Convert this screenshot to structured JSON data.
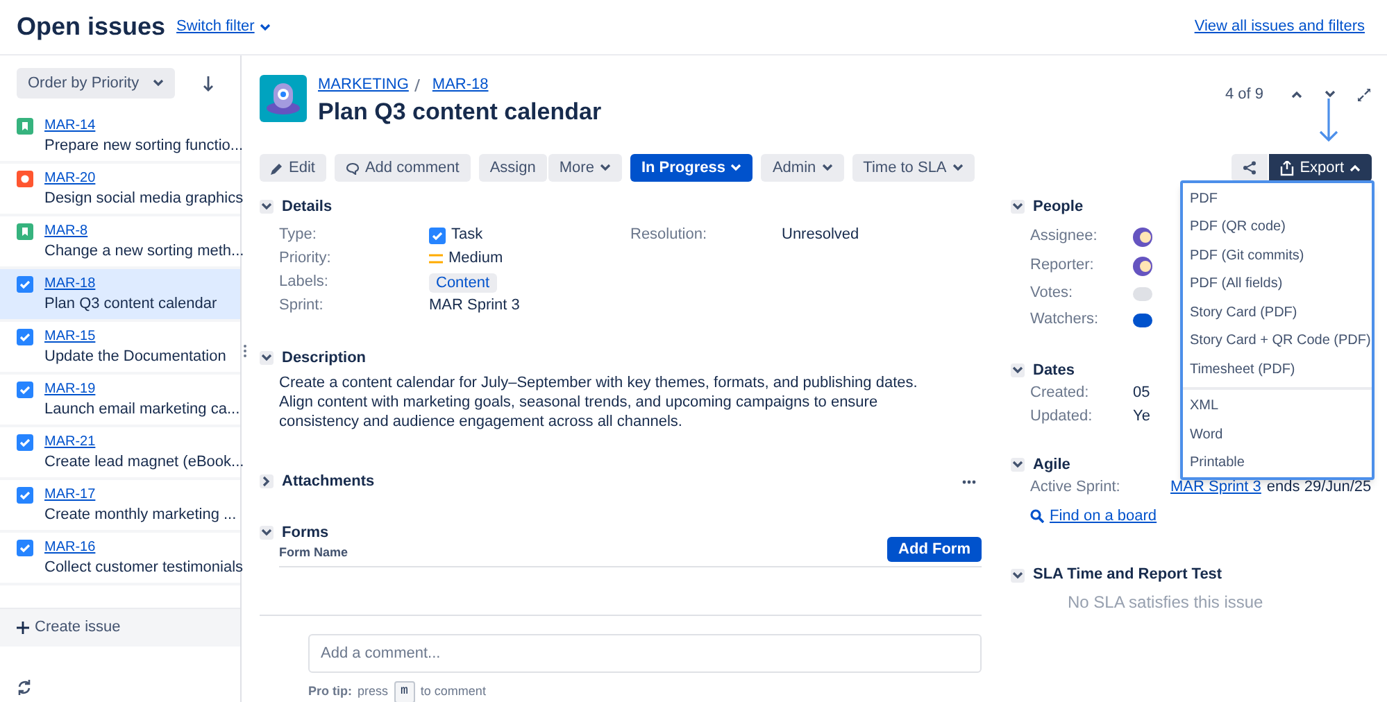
{
  "header": {
    "title": "Open issues",
    "switch_filter": "Switch filter",
    "view_all": "View all issues and filters"
  },
  "sidebar": {
    "order_by": "Order by Priority",
    "issues": [
      {
        "key": "MAR-14",
        "summary": "Prepare new sorting functio...",
        "kind": "story",
        "selected": false
      },
      {
        "key": "MAR-20",
        "summary": "Design social media graphics",
        "kind": "bug",
        "selected": false
      },
      {
        "key": "MAR-8",
        "summary": "Change a new sorting meth...",
        "kind": "story",
        "selected": false
      },
      {
        "key": "MAR-18",
        "summary": "Plan Q3 content calendar",
        "kind": "task",
        "selected": true
      },
      {
        "key": "MAR-15",
        "summary": "Update the Documentation",
        "kind": "task",
        "selected": false
      },
      {
        "key": "MAR-19",
        "summary": "Launch email marketing ca...",
        "kind": "task",
        "selected": false
      },
      {
        "key": "MAR-21",
        "summary": "Create lead magnet (eBook...",
        "kind": "task",
        "selected": false
      },
      {
        "key": "MAR-17",
        "summary": "Create monthly marketing ...",
        "kind": "task",
        "selected": false
      },
      {
        "key": "MAR-16",
        "summary": "Collect customer testimonials",
        "kind": "task",
        "selected": false
      }
    ],
    "create_issue": "Create issue"
  },
  "issue": {
    "project": "MARKETING",
    "key": "MAR-18",
    "summary": "Plan Q3 content calendar",
    "counter": "4 of 9",
    "toolbar": [
      {
        "label": "Edit",
        "kind": "edit"
      },
      {
        "label": "Add comment",
        "kind": "comment"
      },
      {
        "label": "Assign",
        "kind": "plain"
      },
      {
        "label": "More",
        "kind": "menu"
      },
      {
        "label": "In Progress",
        "kind": "status"
      },
      {
        "label": "Admin",
        "kind": "menu"
      },
      {
        "label": "Time to SLA",
        "kind": "menu"
      }
    ],
    "export": {
      "label": "Export",
      "expanded": true,
      "groups": [
        [
          "PDF",
          "PDF (QR code)",
          "PDF (Git commits)",
          "PDF (All fields)",
          "Story Card (PDF)",
          "Story Card + QR Code (PDF)",
          "Timesheet (PDF)"
        ],
        [
          "XML",
          "Word",
          "Printable"
        ]
      ]
    }
  },
  "details": {
    "title": "Details",
    "expanded": true,
    "fields": [
      {
        "label": "Type:",
        "value": "Task",
        "kind": "type"
      },
      {
        "label": "Priority:",
        "value": "Medium",
        "kind": "priority"
      },
      {
        "label": "Labels:",
        "value": "Content",
        "kind": "tag"
      },
      {
        "label": "Sprint:",
        "value": "MAR Sprint 3",
        "kind": "text"
      }
    ],
    "resolution": {
      "label": "Resolution:",
      "value": "Unresolved"
    }
  },
  "description": {
    "title": "Description",
    "expanded": true,
    "text": "Create a content calendar for July–September with key themes, formats, and publishing dates. Align content with marketing goals, seasonal trends, and upcoming campaigns to ensure consistency and audience engagement across all channels."
  },
  "attachments": {
    "title": "Attachments",
    "expanded": false
  },
  "forms": {
    "title": "Forms",
    "expanded": true,
    "column": "Form Name",
    "add_button": "Add Form"
  },
  "comment": {
    "placeholder": "Add a comment...",
    "tip_label": "Pro tip:",
    "tip_before": "press",
    "tip_key": "m",
    "tip_after": "to comment"
  },
  "people": {
    "title": "People",
    "expanded": true,
    "fields": [
      {
        "label": "Assignee:",
        "kind": "avatar"
      },
      {
        "label": "Reporter:",
        "kind": "avatar"
      },
      {
        "label": "Votes:",
        "kind": "count-off"
      },
      {
        "label": "Watchers:",
        "kind": "count-on"
      }
    ]
  },
  "dates": {
    "title": "Dates",
    "expanded": true,
    "fields": [
      {
        "label": "Created:",
        "value": "05"
      },
      {
        "label": "Updated:",
        "value": "Ye"
      }
    ]
  },
  "agile": {
    "title": "Agile",
    "expanded": true,
    "label": "Active Sprint:",
    "sprint": "MAR Sprint 3",
    "ends": "ends 29/Jun/25",
    "find": "Find on a board"
  },
  "sla": {
    "title": "SLA Time and Report Test",
    "expanded": true,
    "empty": "No SLA satisfies this issue"
  }
}
